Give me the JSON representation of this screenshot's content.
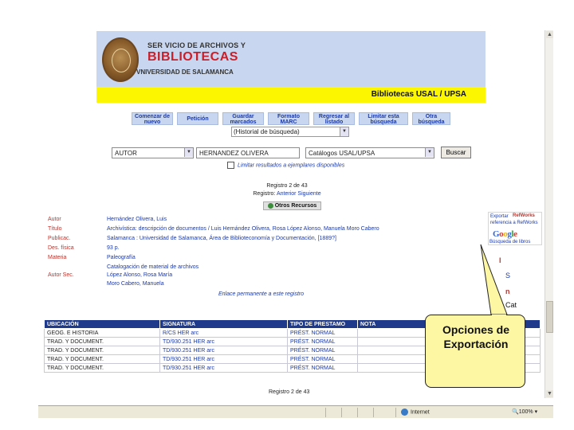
{
  "header": {
    "line1": "SER VICIO DE ARCHIVOS Y",
    "line2": "BIBLIOTECAS",
    "line3": "VNIVERSIDAD DE SALAMANCA",
    "band_label": "Bibliotecas USAL / UPSA",
    "colors": {
      "header_bg": "#c8d6ef",
      "band_bg": "#fcf600",
      "brand_red": "#c8202b",
      "link_blue": "#1c3aa8",
      "table_header": "#1f3a8a"
    }
  },
  "toolbar": {
    "buttons": [
      "Comenzar de nuevo",
      "Petición",
      "Guardar marcados",
      "Formato MARC",
      "Regresar al listado",
      "Limitar esta búsqueda",
      "Otra búsqueda"
    ],
    "history_select": "(Historial de búsqueda)"
  },
  "search": {
    "field_type": "AUTOR",
    "query": "HERNANDEZ OLIVERA",
    "catalog": "Catálogos USAL/UPSA",
    "button": "Buscar",
    "limit_label": "Limitar resultados a ejemplares disponibles"
  },
  "record": {
    "position": "Registro 2 de 43",
    "nav_prefix": "Registro:",
    "nav_prev": "Anterior",
    "nav_next": "Siguiente",
    "otros_recursos": "Otros Recursos",
    "fields": [
      {
        "label": "Autor",
        "value": "Hernández Olivera, Luis"
      },
      {
        "label": "Título",
        "value": "Archivística: descripción de documentos / Luis Hernández Olivera, Rosa López Alonso, Manuela Moro Cabero"
      },
      {
        "label": "Publicac.",
        "value": "Salamanca : Universidad de Salamanca, Área de Biblioteconomía y Documentación, [1889?]"
      },
      {
        "label": "Des. física",
        "value": "93 p."
      },
      {
        "label": "Materia",
        "value": "Paleografía"
      },
      {
        "label": "",
        "value": "Catalogación de material de archivos"
      },
      {
        "label": "Autor Sec.",
        "value": "López Alonso, Rosa María"
      },
      {
        "label": "",
        "value": "Moro Cabero, Manuela"
      }
    ],
    "permalink": "Enlace permanente a este registro"
  },
  "holdings": {
    "headers": [
      "UBICACIÓN",
      "SIGNATURA",
      "TIPO DE PRESTAMO",
      "NOTA"
    ],
    "rows": [
      [
        "GEOG. E HISTORIA",
        "R/CS HER arc",
        "PRÉST. NORMAL",
        ""
      ],
      [
        "TRAD. Y DOCUMENT.",
        "TD/930.251 HER arc",
        "PRÉST. NORMAL",
        ""
      ],
      [
        "TRAD. Y DOCUMENT.",
        "TD/930.251 HER arc",
        "PRÉST. NORMAL",
        ""
      ],
      [
        "TRAD. Y DOCUMENT.",
        "TD/930.251 HER arc",
        "PRÉST. NORMAL",
        ""
      ],
      [
        "TRAD. Y DOCUMENT.",
        "TD/930.251 HER arc",
        "PRÉST. NORMAL",
        ""
      ]
    ],
    "footer": "Registro 2 de 43"
  },
  "export_tools": {
    "line1": "Exportar",
    "refworks": "RefWorks",
    "line2": "referencia a RefWorks",
    "google": "Google",
    "google_books": "Búsqueda de libros",
    "fragments": [
      "l",
      "S",
      "n",
      "Cat"
    ]
  },
  "callout": {
    "text": "Opciones de Exportación"
  },
  "statusbar": {
    "zone": "Internet",
    "zoom": "100%"
  }
}
